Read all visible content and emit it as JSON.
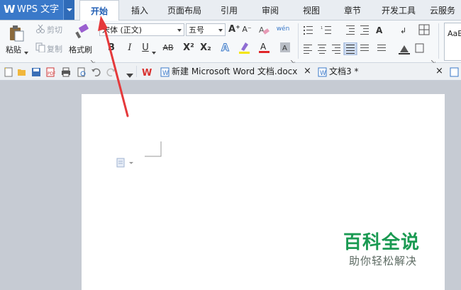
{
  "app": {
    "logo_letter": "W",
    "title": "WPS 文字"
  },
  "menu": {
    "tabs": [
      {
        "label": "开始"
      },
      {
        "label": "插入"
      },
      {
        "label": "页面布局"
      },
      {
        "label": "引用"
      },
      {
        "label": "审阅"
      },
      {
        "label": "视图"
      },
      {
        "label": "章节"
      },
      {
        "label": "开发工具"
      },
      {
        "label": "云服务"
      }
    ],
    "active_index": 0
  },
  "ribbon": {
    "clipboard": {
      "paste": "粘贴",
      "cut": "剪切",
      "copy": "复制",
      "format_painter": "格式刷"
    },
    "font": {
      "family": "宋体 (正文)",
      "size": "五号",
      "bold": "B",
      "italic": "I",
      "underline": "U",
      "strike": "AB",
      "superscript": "X²",
      "subscript": "X₂",
      "grow": "A⁺",
      "shrink": "A⁻",
      "phonetic": "wén"
    },
    "style_preview": "AaB"
  },
  "doc_tabs": [
    {
      "title": "新建 Microsoft Word 文档.docx",
      "close": "×"
    },
    {
      "title": "文档3 *",
      "close": "×"
    }
  ],
  "watermark": {
    "title": "百科全说",
    "subtitle": "助你轻松解决"
  },
  "colors": {
    "accent": "#3a79c9",
    "active_tab_text": "#1f5db4",
    "arrow": "#e5393b",
    "watermark": "#1a9a52"
  }
}
